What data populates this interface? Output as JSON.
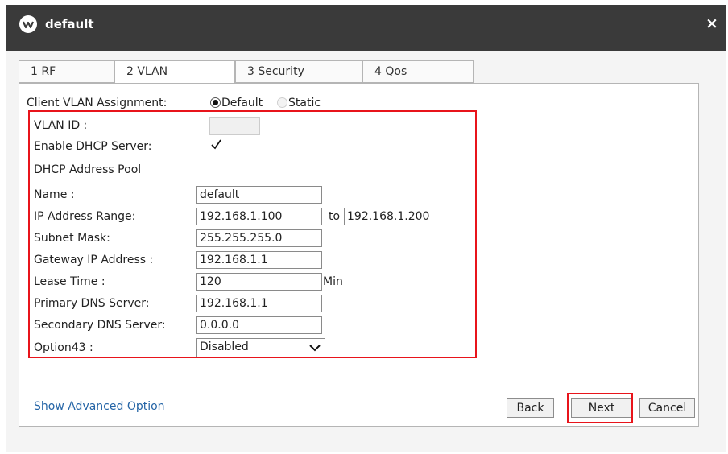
{
  "window": {
    "title": "default",
    "close_glyph": "×"
  },
  "tabs": [
    {
      "label": "1 RF"
    },
    {
      "label": "2 VLAN"
    },
    {
      "label": "3 Security"
    },
    {
      "label": "4 Qos"
    }
  ],
  "active_tab": "2 VLAN",
  "vlan": {
    "assignment_label": "Client VLAN Assignment:",
    "options": [
      {
        "label": "Default",
        "selected": true
      },
      {
        "label": "Static",
        "selected": false
      }
    ],
    "vlan_id_label": "VLAN ID :",
    "vlan_id_value": "",
    "dhcp_label": "Enable DHCP Server:",
    "dhcp_enabled": true,
    "pool_group_label": "DHCP Address Pool"
  },
  "pool": {
    "name_label": "Name :",
    "name_value": "default",
    "range_label": "IP Address Range:",
    "range_start": "192.168.1.100",
    "range_to": "to",
    "range_end": "192.168.1.200",
    "subnet_label": "Subnet Mask:",
    "subnet_value": "255.255.255.0",
    "gateway_label": "Gateway IP Address :",
    "gateway_value": "192.168.1.1",
    "lease_label": "Lease Time :",
    "lease_value": "120",
    "lease_unit": "Min",
    "primary_dns_label": "Primary DNS Server:",
    "primary_dns_value": "192.168.1.1",
    "secondary_dns_label": "Secondary DNS Server:",
    "secondary_dns_value": "0.0.0.0",
    "option43_label": "Option43 :",
    "option43_value": "Disabled"
  },
  "footer": {
    "advanced_link": "Show Advanced Option",
    "back_label": "Back",
    "next_label": "Next",
    "cancel_label": "Cancel"
  },
  "colors": {
    "titlebar": "#3a3a3a",
    "highlight": "#e8141b",
    "link": "#2464a6"
  },
  "icons": {
    "app_logo": "app-logo-icon",
    "close": "close-icon",
    "dropdown": "chevron-down-icon",
    "checkbox": "checkmark-icon"
  }
}
